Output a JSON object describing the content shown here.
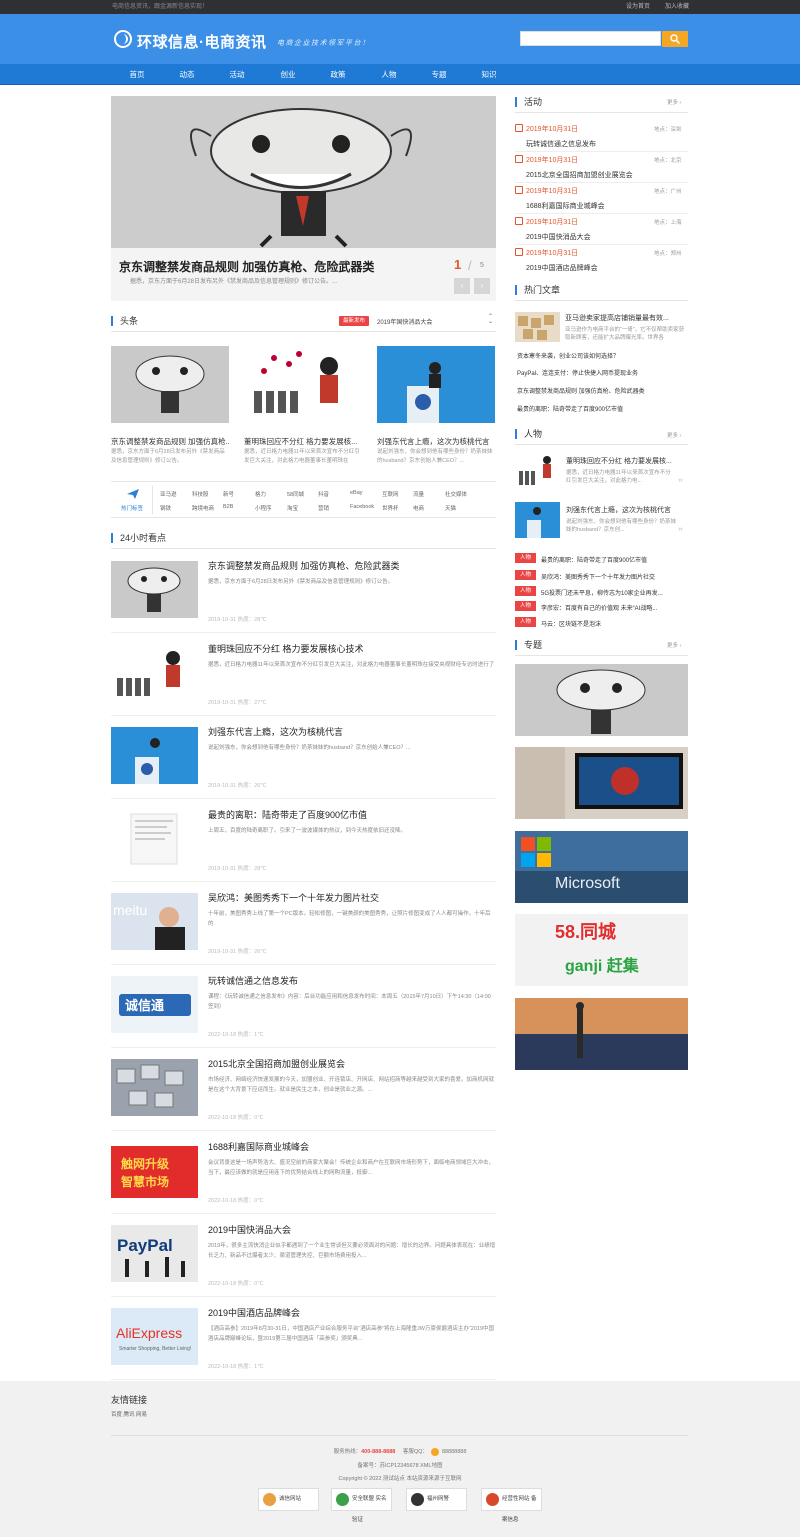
{
  "topbar": {
    "slogan": "电商信息资讯，跟金源新信息实现！",
    "set_home": "设为首页",
    "add_fav": "加入收藏"
  },
  "header": {
    "logo_text": "环球信息·电商资讯",
    "logo_slogan": "电商企业技术领军平台！",
    "search_placeholder": ""
  },
  "nav": [
    "首页",
    "动态",
    "活动",
    "创业",
    "政策",
    "人物",
    "专题",
    "知识"
  ],
  "slider": {
    "title": "京东调整禁发商品规则 加强仿真枪、危险武器类",
    "desc": "据悉，京东方面于6月28日发布另外《禁发商品及信息管理规则》修订公告。...",
    "current": "1",
    "separator": "/",
    "total": "5",
    "prev": "‹",
    "next": "›"
  },
  "headline": {
    "title": "头条",
    "badge": "最新发布",
    "ticker": "2019年国快消品大会",
    "cards": [
      {
        "title": "京东调整禁发商品规则 加强仿真枪...",
        "desc": "据悉，京东方面于6月28日发布另外《禁发商品及信息管理规则》修订公告。"
      },
      {
        "title": "董明珠回应不分红 格力要发展核...",
        "desc": "据悉，近日格力电器11年以来首次宣布不分红引发巨大关注，对此格力电器董事长董明珠在"
      },
      {
        "title": "刘强东代言上瘾，这次为核桃代言",
        "desc": "说起刘强东，你会想到他有哪些身份？奶茶妹妹的husband？京东创始人兼CEO？..."
      }
    ]
  },
  "hot_tags": {
    "label": "热门标签",
    "row1": [
      "亚马逊",
      "科技股",
      "新号",
      "格力",
      "58同城",
      "抖音",
      "eBay",
      "互联网",
      "流量",
      "社交媒体"
    ],
    "row2": [
      "钢铁",
      "跨境电商",
      "B2B",
      "小程序",
      "淘宝",
      "营销",
      "Facebook",
      "世界杯",
      "电商",
      "天猫"
    ]
  },
  "news24": {
    "title": "24小时看点",
    "items": [
      {
        "title": "京东调整禁发商品规则 加强仿真枪、危险武器类",
        "desc": "据悉，京东方面于6月28日发布另外《禁发商品及信息管理规则》修订公告。",
        "meta": "2019-10-31 热度：28℃"
      },
      {
        "title": "董明珠回应不分红 格力要发展核心技术",
        "desc": "据悉，近日格力电器11年以来首次宣布不分红引发巨大关注，对此格力电器董事长董明珠在接受央视财经专访时进行了",
        "meta": "2019-10-31 热度：27℃"
      },
      {
        "title": "刘强东代言上瘾，这次为核桃代言",
        "desc": "说起刘强东，你会想到他有哪些身份？奶茶妹妹的husband？京东创始人兼CEO？...",
        "meta": "2019-10-31 热度：26℃"
      },
      {
        "title": "最贵的离职：陆奇带走了百度900亿市值",
        "desc": "上周五，百度的陆奇离职了。引来了一波波媒体的热议，到今天热度依旧还没降。",
        "meta": "2019-10-31 热度：28℃"
      },
      {
        "title": "吴欣鸿：美图秀秀下一个十年发力图片社交",
        "desc": "十年前，美图秀秀上线了第一个PC版本。轻松修图，一键美颜的美图秀秀，让照片修图变成了人人都可操作。十年后的",
        "meta": "2019-10-31 热度：26℃"
      },
      {
        "title": "玩转诚信通之信息发布",
        "desc": "课程：《玩转诚信通之信息发布》内容：后台功能应用和信息发布时间：本周五（2015年7月10日）下午14:30（14:00签到）",
        "meta": "2022-10-18 热度：1℃"
      },
      {
        "title": "2015北京全国招商加盟创业展览会",
        "desc": "市场经济、网络经济快速发展的今天，加盟创业、开连锁店、开网店、网站招商等越来越受到大家的喜爱。加商机网就是在这个大背景下应运而生。就业是民生之本，创业是就业之源。...",
        "meta": "2022-10-18 热度：0℃"
      },
      {
        "title": "1688利嘉国际商业城峰会",
        "desc": "会议背景这是一场声势浩大、盛况空前的商家大聚会！传统企业和商户在互联网市场形势下，面临电商领域巨大冲击，当下，最应该做的就是应用连下的优势结合线上的网购流量，抵御...",
        "meta": "2022-10-18 热度：0℃"
      },
      {
        "title": "2019中国快消品大会",
        "desc": "2019年，很多主流快消企业似乎都遇到了一个业生常谈但又要必须面对的问题：增长的边界。问题具体表现在：业绩增长乏力、新品不过爆者太少、渠道管理失控、巨额市场费用投入...",
        "meta": "2022-10-18 热度：0℃"
      },
      {
        "title": "2019中国酒店品牌峰会",
        "desc": "【酒店高参】2019年8月30-31日，中国酒店产业综合服务平台“酒店高参”将在上海隆重JW万豪侯爵酒店主办“2019中国酒店品牌巅峰论坛，暨2019第三届中国酒店『高参奖』颁奖典...",
        "meta": "2022-10-18 热度：1℃"
      }
    ]
  },
  "events": {
    "title": "活动",
    "more": "更多 ›",
    "items": [
      {
        "date": "2019年10月31日",
        "loc": "地点：深圳",
        "name": "玩转诚信通之信息发布"
      },
      {
        "date": "2019年10月31日",
        "loc": "地点：北京",
        "name": "2015北京全国招商加盟创业展览会"
      },
      {
        "date": "2019年10月31日",
        "loc": "地点：广州",
        "name": "1688利嘉国际商业城峰会"
      },
      {
        "date": "2019年10月31日",
        "loc": "地点：上海",
        "name": "2019中国快消品大会"
      },
      {
        "date": "2019年10月31日",
        "loc": "地点：郑州",
        "name": "2019中国酒店品牌峰会"
      }
    ]
  },
  "hot_articles": {
    "title": "热门文章",
    "top": {
      "title": "亚马逊卖家提高店铺销量最有效...",
      "desc": "亚马逊作为电商平台的“一哥”，它不仅帮助卖家获取新顾客，还能扩大品牌曝光率。世界各"
    },
    "links": [
      "资本寒冬来袭，创业公司该如何选择？",
      "PayPal、连连支付：停止快捷入网币提现业务",
      "京东调整禁发商品规则 加强仿真枪、危险武器类",
      "最贵的离职：陆奇带走了百度900亿市值"
    ]
  },
  "people": {
    "title": "人物",
    "more": "更多 ›",
    "cards": [
      {
        "title": "董明珠回应不分红 格力要发展核...",
        "desc": "据悉，近日格力电器11年以来首次宣布不分红引发巨大关注，对此格力电..."
      },
      {
        "title": "刘强东代言上瘾，这次为核桃代言",
        "desc": "说起刘强东，你会想到他有哪些身份？奶茶妹妹的husband？京东创..."
      }
    ],
    "badge": "人物",
    "links": [
      "最贵的离职：陆奇带走了百度900亿市值",
      "吴欣鸿：美图秀秀下一个十年发力图片社交",
      "5G投票门还未平息，柳传志为10家企业再发...",
      "李彦宏：百度有自己的价值观 未来“AI战略...",
      "马云：区块链不是泡沫"
    ]
  },
  "topics": {
    "title": "专题",
    "more": "更多 ›",
    "labels": [
      "58.同城",
      "ganji 赶集",
      "Microsoft"
    ]
  },
  "footer": {
    "friend_title": "友情链接",
    "friend_links": "百度  腾讯  网易",
    "hotline_label": "服务热线：",
    "hotline": "400-888-8888",
    "qq_label": "客服QQ：",
    "qq": "88888888",
    "icp": "备案号：苏ICP12345678 XML地图",
    "copyright": "Copyright © 2022 测试站点 本站资源来源于互联网",
    "certs": [
      "诚信网站",
      "安全联盟 实名验证",
      "福州网警",
      "经营性网站 备案信息"
    ]
  },
  "colors": {
    "brand": "#3b8fe6",
    "nav": "#1f7ad6",
    "accent": "#e4572e",
    "search_btn": "#f5a623",
    "badge": "#e94545"
  }
}
